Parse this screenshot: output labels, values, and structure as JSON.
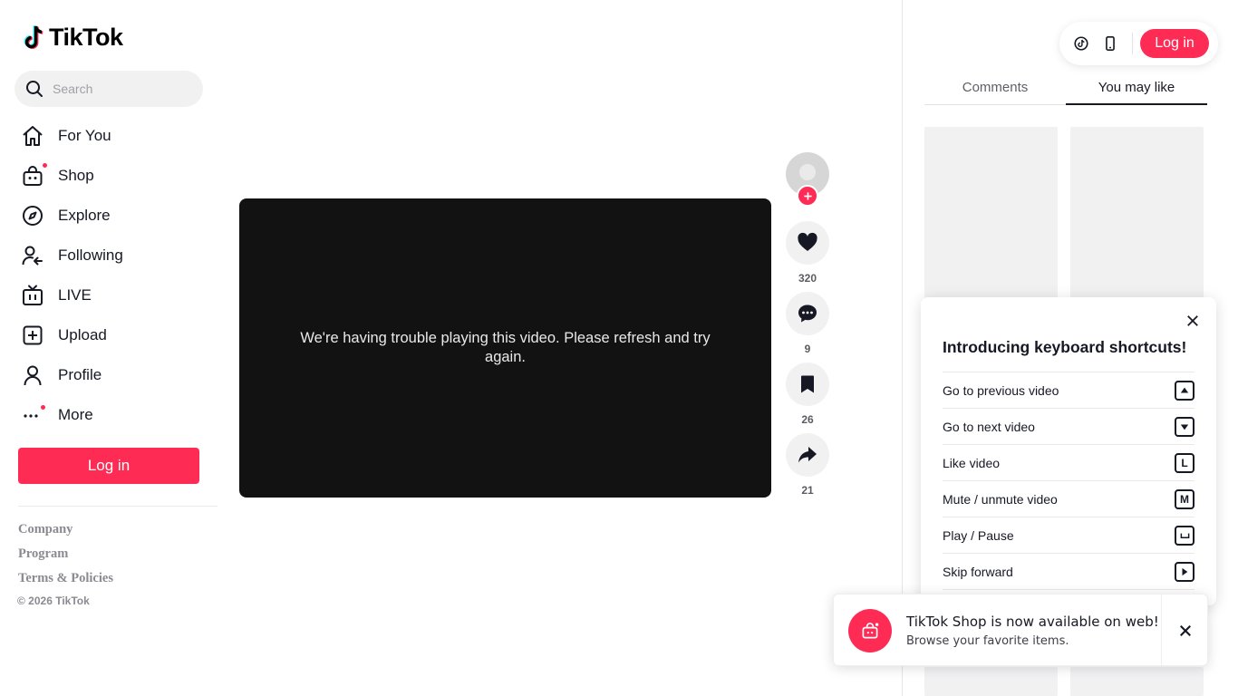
{
  "brand": {
    "name": "TikTok"
  },
  "search": {
    "placeholder": "Search"
  },
  "nav": {
    "items": [
      {
        "label": "For You",
        "icon": "home-icon"
      },
      {
        "label": "Shop",
        "icon": "shop-bag-icon",
        "badge": true
      },
      {
        "label": "Explore",
        "icon": "compass-icon"
      },
      {
        "label": "Following",
        "icon": "following-user-icon"
      },
      {
        "label": "LIVE",
        "icon": "live-tv-icon"
      },
      {
        "label": "Upload",
        "icon": "upload-plus-icon"
      },
      {
        "label": "Profile",
        "icon": "profile-user-icon"
      },
      {
        "label": "More",
        "icon": "more-dots-icon",
        "badge": true
      }
    ],
    "login_label": "Log in"
  },
  "footer": {
    "links": [
      "Company",
      "Program",
      "Terms & Policies"
    ],
    "copyright": "© 2026 TikTok"
  },
  "video": {
    "error_message": "We're having trouble playing this video. Please refresh and try again."
  },
  "actions": {
    "likes": "320",
    "comments": "9",
    "saves": "26",
    "shares": "21"
  },
  "header": {
    "login_label": "Log in"
  },
  "tabs": [
    {
      "label": "Comments",
      "active": false
    },
    {
      "label": "You may like",
      "active": true
    }
  ],
  "shortcuts": {
    "title": "Introducing keyboard shortcuts!",
    "items": [
      {
        "label": "Go to previous video",
        "key": "up-arrow"
      },
      {
        "label": "Go to next video",
        "key": "down-arrow"
      },
      {
        "label": "Like video",
        "key": "L"
      },
      {
        "label": "Mute / unmute video",
        "key": "M"
      },
      {
        "label": "Play / Pause",
        "key": "space"
      },
      {
        "label": "Skip forward",
        "key": "right-arrow"
      }
    ]
  },
  "toast": {
    "title": "TikTok Shop is now available on web!",
    "subtitle": "Browse your favorite items."
  },
  "colors": {
    "accent": "#fe2c55",
    "text": "#161823",
    "muted": "#8a8b91"
  }
}
